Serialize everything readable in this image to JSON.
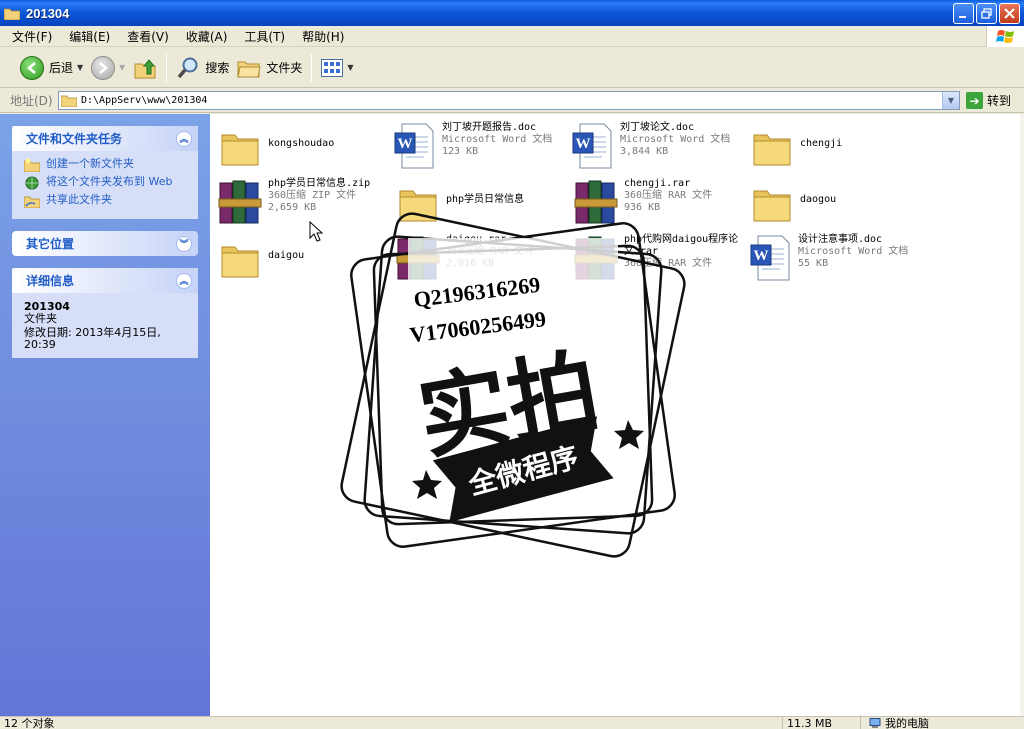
{
  "window": {
    "title": "201304"
  },
  "menu": [
    "文件(F)",
    "编辑(E)",
    "查看(V)",
    "收藏(A)",
    "工具(T)",
    "帮助(H)"
  ],
  "toolbar": {
    "back_label": "后退",
    "search_label": "搜索",
    "folders_label": "文件夹"
  },
  "address": {
    "label": "地址(D)",
    "value": "D:\\AppServ\\www\\201304",
    "go_label": "转到"
  },
  "left_pane": {
    "tasks": {
      "title": "文件和文件夹任务",
      "items": [
        "创建一个新文件夹",
        "将这个文件夹发布到 Web",
        "共享此文件夹"
      ]
    },
    "other": {
      "title": "其它位置"
    },
    "details": {
      "title": "详细信息",
      "name": "201304",
      "type": "文件夹",
      "modified": "修改日期: 2013年4月15日, 20:39"
    }
  },
  "files": [
    {
      "name": "kongshoudao",
      "type": "",
      "size": "",
      "icon": "folder-icon"
    },
    {
      "name": "刘丁坡开题报告.doc",
      "type": "Microsoft Word 文档",
      "size": "123 KB",
      "icon": "word-doc-icon"
    },
    {
      "name": "刘丁坡论文.doc",
      "type": "Microsoft Word 文档",
      "size": "3,844 KB",
      "icon": "word-doc-icon"
    },
    {
      "name": "chengji",
      "type": "",
      "size": "",
      "icon": "folder-icon"
    },
    {
      "name": "php学员日常信息.zip",
      "type": "360压缩 ZIP 文件",
      "size": "2,659 KB",
      "icon": "archive-icon"
    },
    {
      "name": "php学员日常信息",
      "type": "",
      "size": "",
      "icon": "folder-icon"
    },
    {
      "name": "chengji.rar",
      "type": "360压缩 RAR 文件",
      "size": "936 KB",
      "icon": "archive-icon"
    },
    {
      "name": "daogou",
      "type": "",
      "size": "",
      "icon": "folder-icon"
    },
    {
      "name": "daigou",
      "type": "",
      "size": "",
      "icon": "folder-icon"
    },
    {
      "name": "daigou.rar",
      "type": "360压缩 RAR 文件",
      "size": "2,016 KB",
      "icon": "archive-icon"
    },
    {
      "name": "php代购网daigou程序论文.rar",
      "type": "360压缩 RAR 文件",
      "size": "",
      "icon": "archive-icon"
    },
    {
      "name": "设计注意事项.doc",
      "type": "Microsoft Word 文档",
      "size": "55 KB",
      "icon": "word-doc-icon"
    }
  ],
  "watermark": {
    "line1": "Q2196316269",
    "line2": "V17060256499",
    "main": "实拍",
    "banner": "全微程序"
  },
  "status": {
    "count": "12 个对象",
    "size": "11.3 MB",
    "location": "我的电脑"
  },
  "colors": {
    "title_bar": "#0a55d8",
    "left_pane": "#6f8fe0",
    "link": "#215dc6"
  }
}
